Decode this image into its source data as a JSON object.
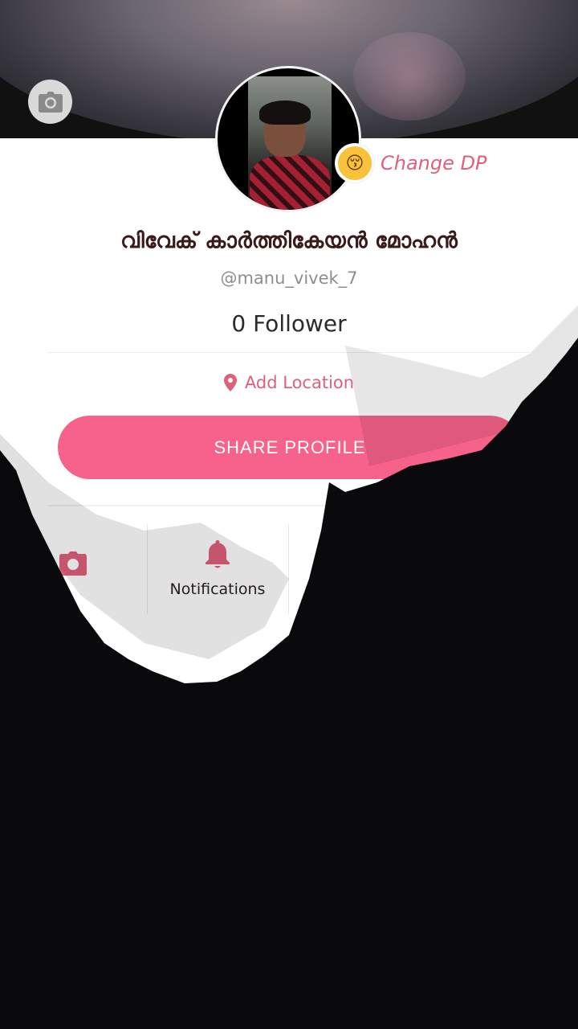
{
  "profile": {
    "display_name": "വിവേക് കാർത്തികേയൻ മോഹൻ",
    "handle": "@manu_vivek_7",
    "followers": "0 Follower",
    "change_dp_label": "Change DP",
    "change_dp_emoji": "😚",
    "location_label": "Add Location",
    "share_label": "SHARE PROFILE"
  },
  "tabs": [
    {
      "label": "",
      "icon": "camera-icon"
    },
    {
      "label": "Notifications",
      "icon": "bell-icon"
    }
  ],
  "colors": {
    "accent": "#f7628a",
    "accent_text": "#e0607c",
    "name_text": "#3b1a1a"
  }
}
